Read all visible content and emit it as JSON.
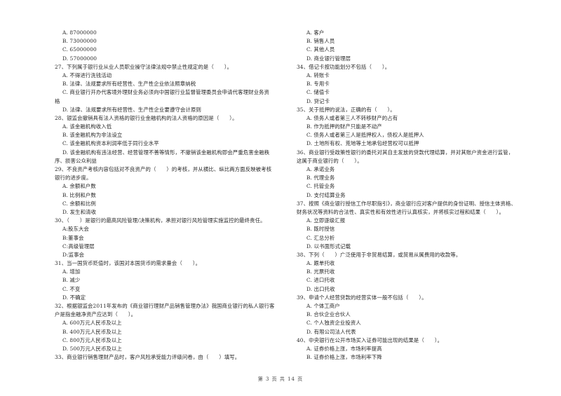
{
  "page": {
    "footer": "第 3 页 共 14 页"
  },
  "left_column": [
    {
      "type": "opt",
      "text": "A. 87000000"
    },
    {
      "type": "opt",
      "text": "B. 73000000"
    },
    {
      "type": "opt",
      "text": "C. 65000000"
    },
    {
      "type": "opt",
      "text": "D. 57000000"
    },
    {
      "type": "q",
      "text": "27、下列属于银行业从业人员职业操守法律法规中禁止性规定的是（　　）。"
    },
    {
      "type": "opt",
      "text": "A. 不得进行洗钱活动"
    },
    {
      "type": "opt",
      "text": "B. 法律、法规要求所有经营性、生产性企业依法照章纳税"
    },
    {
      "type": "opt",
      "text": "C. 商业银行开办代客境外理财业务必须向中国银行业监督管理委员会申请代客理财业务资"
    },
    {
      "type": "cont",
      "text": "格"
    },
    {
      "type": "opt",
      "text": "D. 法律、法规要求所有经营性、生产性企业要遵守会计原则"
    },
    {
      "type": "q",
      "text": "28、银监会撤销具有法人资格的银行业金融机构的法人资格的原因是（　　）。"
    },
    {
      "type": "opt",
      "text": "A. 该金融机构收入低"
    },
    {
      "type": "opt",
      "text": "B. 该金融机构为非法设立"
    },
    {
      "type": "opt",
      "text": "C. 该金融机构资本利润率低于同行业水平"
    },
    {
      "type": "opt",
      "text": "D. 该金融机构有违法经营、经营管理不善等情形，不撤销该金融机构即会严重危害金融秩"
    },
    {
      "type": "cont",
      "text": "序、损害公众利益"
    },
    {
      "type": "q",
      "text": "29、不良资产考核内容包括对不良资产的（　　）的考核，并从横比、纵比两方面反映被考核"
    },
    {
      "type": "cont",
      "text": "银行的进步度。"
    },
    {
      "type": "opt",
      "text": "A.  余额和户数"
    },
    {
      "type": "opt",
      "text": "B.  比例和户数"
    },
    {
      "type": "opt",
      "text": "C.  余额和比例"
    },
    {
      "type": "opt",
      "text": "D.  发生和清收"
    },
    {
      "type": "q",
      "text": "30、（　　）是银行的最高风险管理/决策机构，承担对银行风险管理实施监控的最终责任。"
    },
    {
      "type": "opt",
      "text": "A:股东大会"
    },
    {
      "type": "opt",
      "text": "B:董事会"
    },
    {
      "type": "opt",
      "text": "C:高级管理层"
    },
    {
      "type": "opt",
      "text": "D:监事会"
    },
    {
      "type": "q",
      "text": "31、当一国货币贬值时，该国对本国货币的需求量会（　　）。"
    },
    {
      "type": "opt",
      "text": "A. 增加"
    },
    {
      "type": "opt",
      "text": "B. 减少"
    },
    {
      "type": "opt",
      "text": "C. 不变"
    },
    {
      "type": "opt",
      "text": "D. 不确定"
    },
    {
      "type": "q",
      "text": "32、根据银监会2011年发布的《商业银行理财产品销售管理办法》我国商业银行的私人银行客"
    },
    {
      "type": "cont",
      "text": "户是指金融净资产应达到（　　）。"
    },
    {
      "type": "opt",
      "text": "A. 600万元人民币及以上"
    },
    {
      "type": "opt",
      "text": "B. 400万元人民币及以上"
    },
    {
      "type": "opt",
      "text": "C. 800万元人民币及以上"
    },
    {
      "type": "opt",
      "text": "D. 500万元人民币及以上"
    },
    {
      "type": "q",
      "text": "33、商业银行销售理财产品时，客户风险承受能力评级问卷，由（　　）填写。"
    }
  ],
  "right_column": [
    {
      "type": "opt",
      "text": "A. 客户"
    },
    {
      "type": "opt",
      "text": "B. 销售人员"
    },
    {
      "type": "opt",
      "text": "C. 其他人员"
    },
    {
      "type": "opt",
      "text": "D. 商业银行管理层"
    },
    {
      "type": "q",
      "text": "34、借记卡按功能划分不包括（　　）。"
    },
    {
      "type": "opt",
      "text": "A. 转账卡"
    },
    {
      "type": "opt",
      "text": "B. 专用卡"
    },
    {
      "type": "opt",
      "text": "C. 储值卡"
    },
    {
      "type": "opt",
      "text": "D. 贷记卡"
    },
    {
      "type": "q",
      "text": "35、关于抵押的说法，正确的有（　　）。"
    },
    {
      "type": "opt",
      "text": "A.  债务人或者第三人不转移财产的占有"
    },
    {
      "type": "opt",
      "text": "B.  作为抵押的财产只能是不动产"
    },
    {
      "type": "opt",
      "text": "C.  债务人或者第三人是抵押权人，债权人是抵押人"
    },
    {
      "type": "opt",
      "text": "D.  土地所有权、荒地等土地承包经营权可以抵押"
    },
    {
      "type": "q",
      "text": "36、商业银行受政策性银行的委托对其自主发放的贷款代理结算，并对其账户资金进行监管，"
    },
    {
      "type": "cont",
      "text": "这属于商业银行的（　　）。"
    },
    {
      "type": "opt",
      "text": "A. 承诺业务"
    },
    {
      "type": "opt",
      "text": "B. 代理业务"
    },
    {
      "type": "opt",
      "text": "C. 托管业务"
    },
    {
      "type": "opt",
      "text": "D. 支付结算业务"
    },
    {
      "type": "q",
      "text": "37、按照《商业银行授信工作尽职指引》，商业银行应对客户提供的身份证明、授信主体资格、"
    },
    {
      "type": "cont",
      "text": "财务状况等资料的合法性、真实性和有效性进行认真核实，并将核实过程和结果（　　）。"
    },
    {
      "type": "opt",
      "text": "A. 立即逐级汇报"
    },
    {
      "type": "opt",
      "text": "B. 既时授信"
    },
    {
      "type": "opt",
      "text": "C. 汇总分析"
    },
    {
      "type": "opt",
      "text": "D. 以书面形式记载"
    },
    {
      "type": "q",
      "text": "38、下列（　　）广泛使用于非贸易结算，或贸易从属费用的收款等。"
    },
    {
      "type": "opt",
      "text": "A. 跟单托收"
    },
    {
      "type": "opt",
      "text": "B. 光票托收"
    },
    {
      "type": "opt",
      "text": "C. 进口托收"
    },
    {
      "type": "opt",
      "text": "D. 出口托收"
    },
    {
      "type": "q",
      "text": "39、申请个人经营贷款的经营实体一般不包括（　　）。"
    },
    {
      "type": "opt",
      "text": "A. 个体工商户"
    },
    {
      "type": "opt",
      "text": "B. 合伙企业合伙人"
    },
    {
      "type": "opt",
      "text": "C. 个人独资企业投资人"
    },
    {
      "type": "opt",
      "text": "D. 有限公司法人代表"
    },
    {
      "type": "q",
      "text": "40、中央银行在公开市场买入证券可能出现的结果是（　　）。"
    },
    {
      "type": "opt",
      "text": "A.  证券价格上涨，市场利率提高"
    },
    {
      "type": "opt",
      "text": "B.  证券价格上涨，市场利率下降"
    }
  ]
}
